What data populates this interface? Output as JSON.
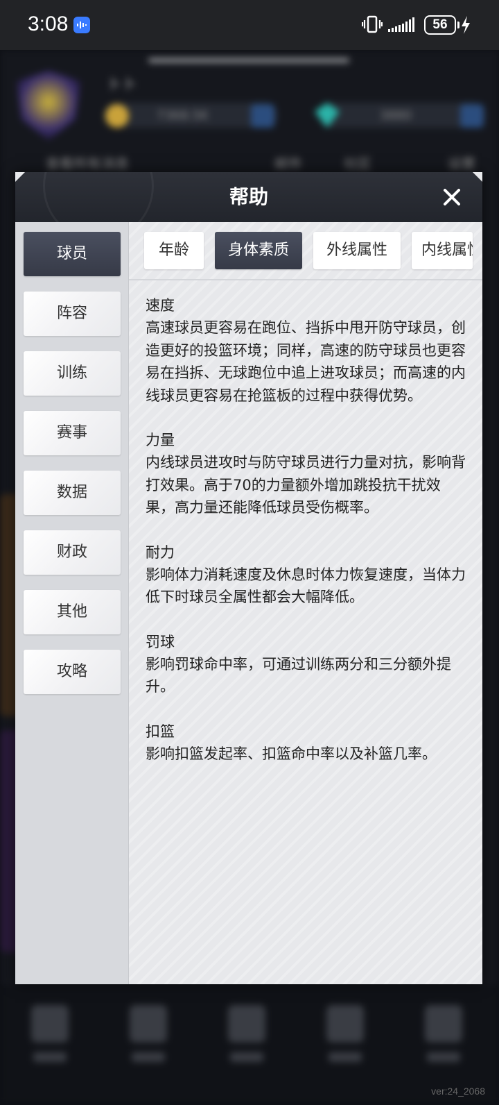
{
  "status_bar": {
    "time": "3:08",
    "battery": "56",
    "icons": [
      "voice-assistant-icon",
      "vibrate-icon",
      "signal-icon",
      "battery-icon",
      "charging-icon"
    ]
  },
  "background_app": {
    "team_name": "トト",
    "coins": "7368.5K",
    "gems": "3880",
    "nav_items": [
      "查看所有消息",
      "邮件",
      "社区",
      "设置"
    ],
    "bottom_tabs": [
      "球员",
      "赛事",
      "战术",
      "球馆",
      "更多"
    ],
    "version": "ver:24_2068"
  },
  "modal": {
    "title": "帮助",
    "close_icon": "close-icon",
    "sidebar": [
      "球员",
      "阵容",
      "训练",
      "赛事",
      "数据",
      "财政",
      "其他",
      "攻略"
    ],
    "active_sidebar": 0,
    "tabs": [
      "年龄",
      "身体素质",
      "外线属性",
      "内线属性"
    ],
    "active_tab": 1,
    "sections": [
      {
        "title": "速度",
        "body": "高速球员更容易在跑位、挡拆中甩开防守球员，创造更好的投篮环境；同样，高速的防守球员也更容易在挡拆、无球跑位中追上进攻球员；而高速的内线球员更容易在抢篮板的过程中获得优势。"
      },
      {
        "title": "力量",
        "body": "内线球员进攻时与防守球员进行力量对抗，影响背打效果。高于70的力量额外增加跳投抗干扰效果，高力量还能降低球员受伤概率。"
      },
      {
        "title": "耐力",
        "body": "影响体力消耗速度及休息时体力恢复速度，当体力低下时球员全属性都会大幅降低。"
      },
      {
        "title": "罚球",
        "body": "影响罚球命中率，可通过训练两分和三分额外提升。"
      },
      {
        "title": "扣篮",
        "body": "影响扣篮发起率、扣篮命中率以及补篮几率。"
      }
    ]
  }
}
